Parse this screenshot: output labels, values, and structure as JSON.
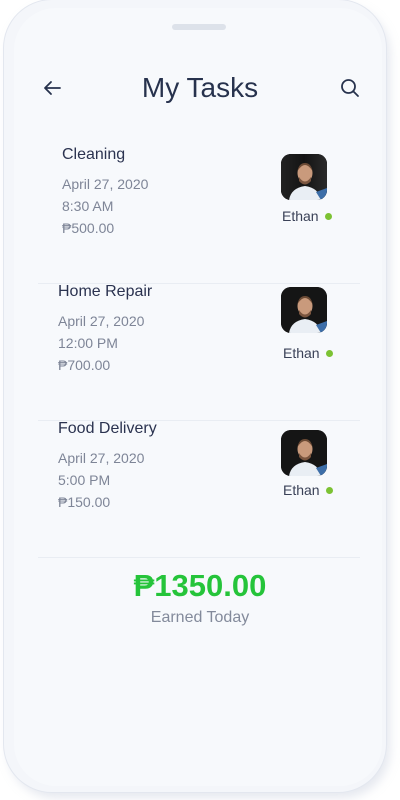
{
  "header": {
    "title": "My Tasks",
    "back_icon": "arrow-left-icon",
    "search_icon": "search-icon"
  },
  "tasks": [
    {
      "name": "Cleaning",
      "date": "April 27, 2020",
      "time": "8:30 AM",
      "price": "₱500.00",
      "worker": "Ethan",
      "status": "online"
    },
    {
      "name": "Home Repair",
      "date": "April 27, 2020",
      "time": "12:00 PM",
      "price": "₱700.00",
      "worker": "Ethan",
      "status": "online"
    },
    {
      "name": "Food Delivery",
      "date": "April 27, 2020",
      "time": "5:00 PM",
      "price": "₱150.00",
      "worker": "Ethan",
      "status": "online"
    }
  ],
  "summary": {
    "total": "₱1350.00",
    "label": "Earned Today"
  },
  "colors": {
    "title": "#27324d",
    "earned": "#25c43a",
    "online_dot": "#7cc233"
  }
}
